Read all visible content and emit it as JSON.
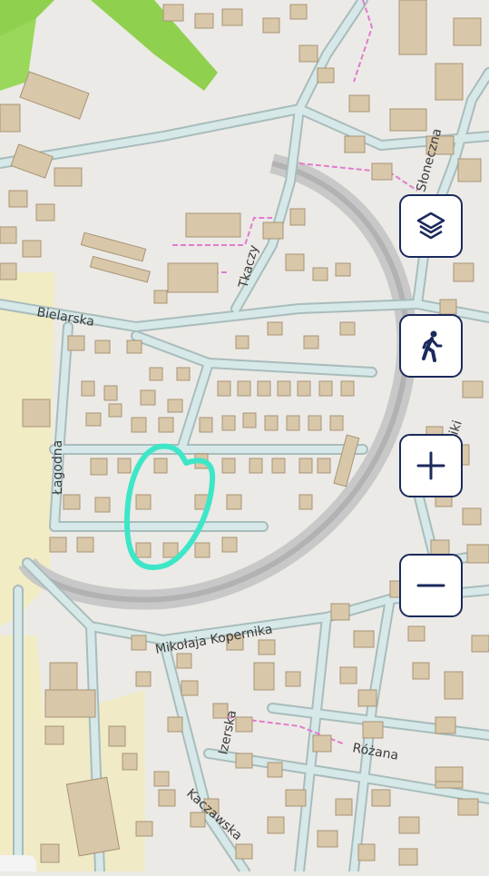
{
  "map": {
    "streets": [
      {
        "id": "bielarska",
        "label": "Bielarska"
      },
      {
        "id": "tkaczy",
        "label": "Tkaczy"
      },
      {
        "id": "sloneczna",
        "label": "Słoneczna"
      },
      {
        "id": "lagodna",
        "label": "Łagodna"
      },
      {
        "id": "kopernika",
        "label": "Mikołaja Kopernika"
      },
      {
        "id": "izerska",
        "label": "Izerska"
      },
      {
        "id": "rozana",
        "label": "Różana"
      },
      {
        "id": "kaczawska",
        "label": "Kaczawska"
      },
      {
        "id": "partial",
        "label": "iki"
      }
    ],
    "colors": {
      "background": "#eceae6",
      "road": "#cfe2e2",
      "road_casing": "#a8bcbc",
      "building": "#d8c7a8",
      "building_edge": "#a89478",
      "green": "#8fd14f",
      "sand": "#f1ecc4",
      "ring_track": "#b9b9b9",
      "path_pink": "#e27bd0",
      "highlight": "#3ee6c8"
    }
  },
  "controls": {
    "layers": {
      "icon": "layers-icon"
    },
    "walk": {
      "icon": "pedestrian-icon"
    },
    "zoom_in": {
      "icon": "plus-icon"
    },
    "zoom_out": {
      "icon": "minus-icon"
    },
    "border_color": "#1b2a5c",
    "icon_color": "#1b2a5c"
  }
}
